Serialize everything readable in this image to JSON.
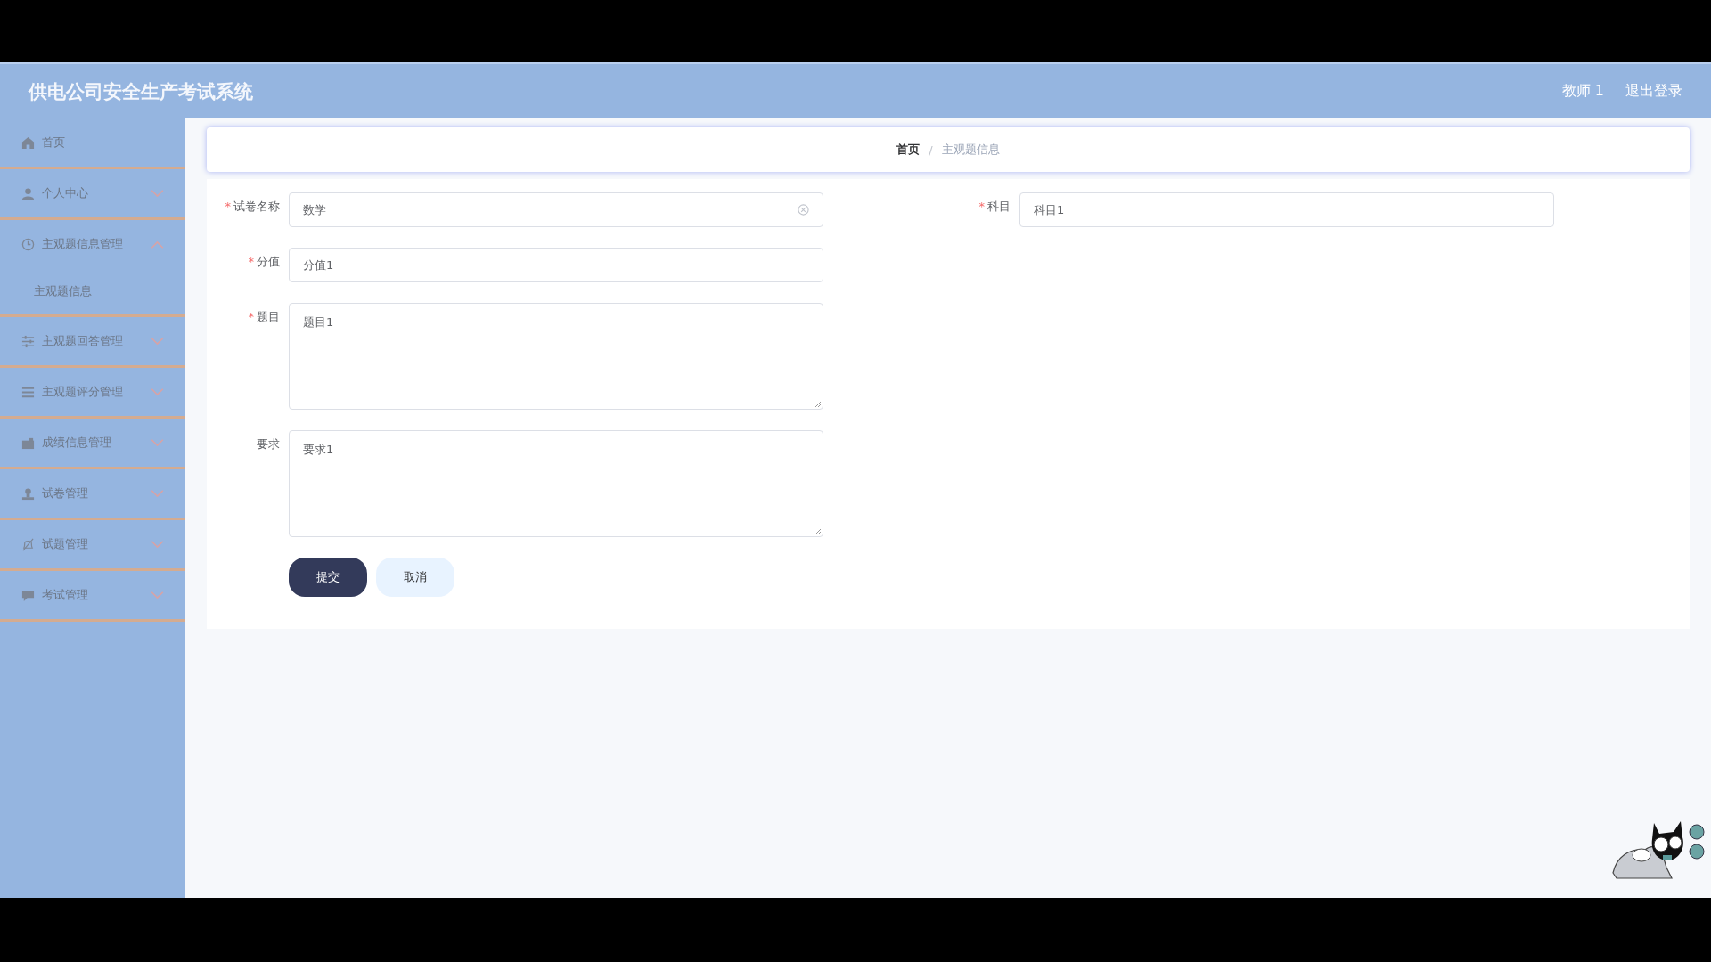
{
  "header": {
    "title": "供电公司安全生产考试系统",
    "user": "教师 1",
    "logout": "退出登录"
  },
  "sidebar": {
    "items": [
      {
        "label": "首页",
        "kind": "link"
      },
      {
        "label": "个人中心",
        "kind": "group",
        "expanded": false
      },
      {
        "label": "主观题信息管理",
        "kind": "group",
        "expanded": true,
        "children": [
          {
            "label": "主观题信息"
          }
        ]
      },
      {
        "label": "主观题回答管理",
        "kind": "group",
        "expanded": false
      },
      {
        "label": "主观题评分管理",
        "kind": "group",
        "expanded": false
      },
      {
        "label": "成绩信息管理",
        "kind": "group",
        "expanded": false
      },
      {
        "label": "试卷管理",
        "kind": "group",
        "expanded": false
      },
      {
        "label": "试题管理",
        "kind": "group",
        "expanded": false
      },
      {
        "label": "考试管理",
        "kind": "group",
        "expanded": false
      }
    ]
  },
  "breadcrumb_separator": "/",
  "breadcrumb": [
    {
      "label": "首页",
      "current": false
    },
    {
      "label": "主观题信息",
      "current": true
    }
  ],
  "form": {
    "required_mark": "*",
    "columns": [
      [
        {
          "label": "试卷名称",
          "kind": "input",
          "required": true,
          "value": "数学",
          "clearable": true
        },
        {
          "label": "分值",
          "kind": "input",
          "required": true,
          "value": "分值1",
          "clearable": false
        },
        {
          "label": "题目",
          "kind": "textarea",
          "required": true,
          "value": "题目1"
        },
        {
          "label": "要求",
          "kind": "textarea",
          "required": false,
          "value": "要求1"
        }
      ],
      [
        {
          "label": "科目",
          "kind": "input",
          "required": true,
          "value": "科目1",
          "clearable": false
        }
      ]
    ],
    "buttons": [
      {
        "label": "提交",
        "kind": "primary"
      },
      {
        "label": "取消",
        "kind": "secondary"
      }
    ]
  }
}
